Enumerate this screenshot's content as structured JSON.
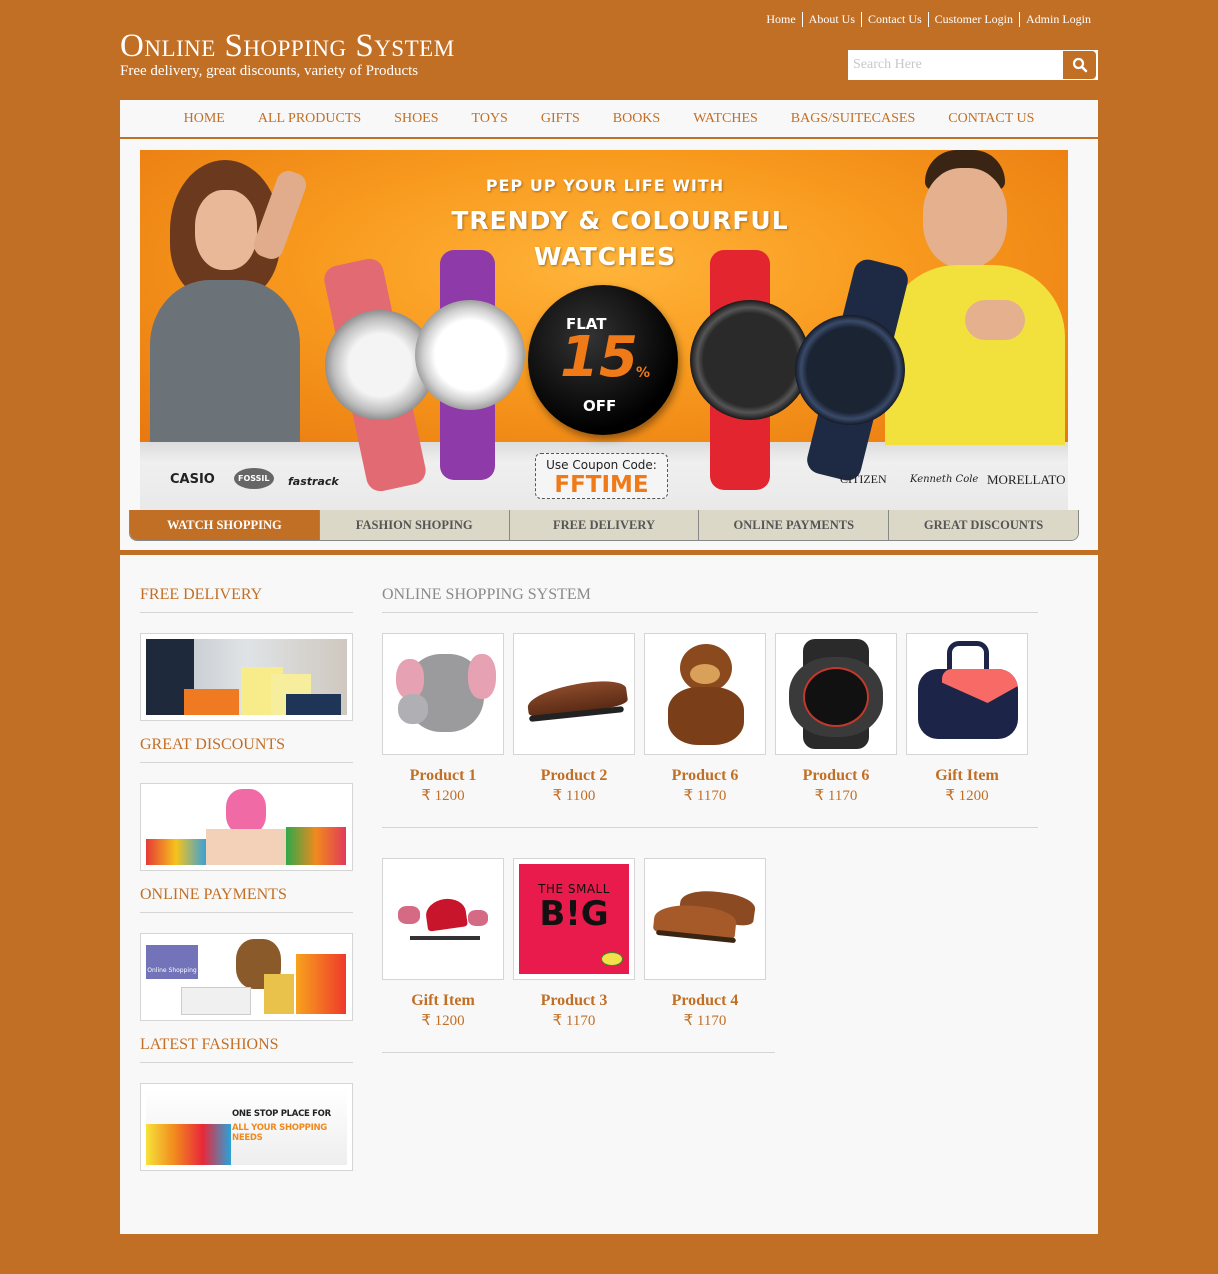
{
  "header": {
    "title": "Online Shopping System",
    "tagline": "Free delivery, great discounts, variety of Products",
    "top_links": [
      "Home",
      "About Us",
      "Contact Us",
      "Customer Login",
      "Admin Login"
    ],
    "search": {
      "placeholder": "Search Here",
      "value": ""
    }
  },
  "nav": [
    "HOME",
    "ALL PRODUCTS",
    "SHOES",
    "TOYS",
    "GIFTS",
    "BOOKS",
    "WATCHES",
    "BAGS/SUITECASES",
    "CONTACT US"
  ],
  "banner": {
    "line1": "PEP UP YOUR LIFE WITH",
    "line2": "TRENDY & COLOURFUL",
    "line3": "WATCHES",
    "sticker_flat": "FLAT",
    "sticker_num": "15",
    "sticker_pct": "%",
    "sticker_off": "OFF",
    "coupon_label": "Use Coupon Code:",
    "coupon_code": "FFTIME",
    "brands_left": [
      "CASIO",
      "FOSSIL",
      "fastrack"
    ],
    "brands_right": [
      "CITIZEN",
      "Kenneth Cole",
      "MORELLATO"
    ]
  },
  "slider_tabs": [
    {
      "label": "WATCH SHOPPING",
      "active": true
    },
    {
      "label": "FASHION SHOPING",
      "active": false
    },
    {
      "label": "FREE DELIVERY",
      "active": false
    },
    {
      "label": "ONLINE PAYMENTS",
      "active": false
    },
    {
      "label": "GREAT DISCOUNTS",
      "active": false
    }
  ],
  "sidebar": [
    {
      "title": "FREE DELIVERY",
      "image": "shopping-bags-photo"
    },
    {
      "title": "GREAT DISCOUNTS",
      "image": "woman-with-bags-photo"
    },
    {
      "title": "ONLINE PAYMENTS",
      "image": "online-shopping-laptop-photo",
      "badge": "Online Shopping"
    },
    {
      "title": "LATEST FASHIONS",
      "image": "one-stop-shop-banner",
      "text1": "ONE STOP PLACE FOR",
      "text2": "ALL YOUR SHOPPING NEEDS"
    }
  ],
  "main": {
    "title": "ONLINE SHOPPING SYSTEM",
    "currency": "₹",
    "rows": [
      [
        {
          "name": "Product 1",
          "price": "1200",
          "image": "elephant-plush-toy"
        },
        {
          "name": "Product 2",
          "price": "1100",
          "image": "brown-formal-shoe"
        },
        {
          "name": "Product 6",
          "price": "1170",
          "image": "teddy-bear"
        },
        {
          "name": "Product 6",
          "price": "1170",
          "image": "g-shock-watch"
        },
        {
          "name": "Gift Item",
          "price": "1200",
          "image": "puma-duffel-bag"
        }
      ],
      [
        {
          "name": "Gift Item",
          "price": "1200",
          "image": "heart-gift-set"
        },
        {
          "name": "Product 3",
          "price": "1170",
          "image": "book-the-small-big",
          "book_title1": "THE SMALL",
          "book_title2": "B!G"
        },
        {
          "name": "Product 4",
          "price": "1170",
          "image": "brown-brogue-shoes"
        }
      ]
    ]
  },
  "colors": {
    "brand": "#c26f26",
    "page_bg": "#f8f8f8",
    "tab_bg": "#dcd8c8"
  }
}
